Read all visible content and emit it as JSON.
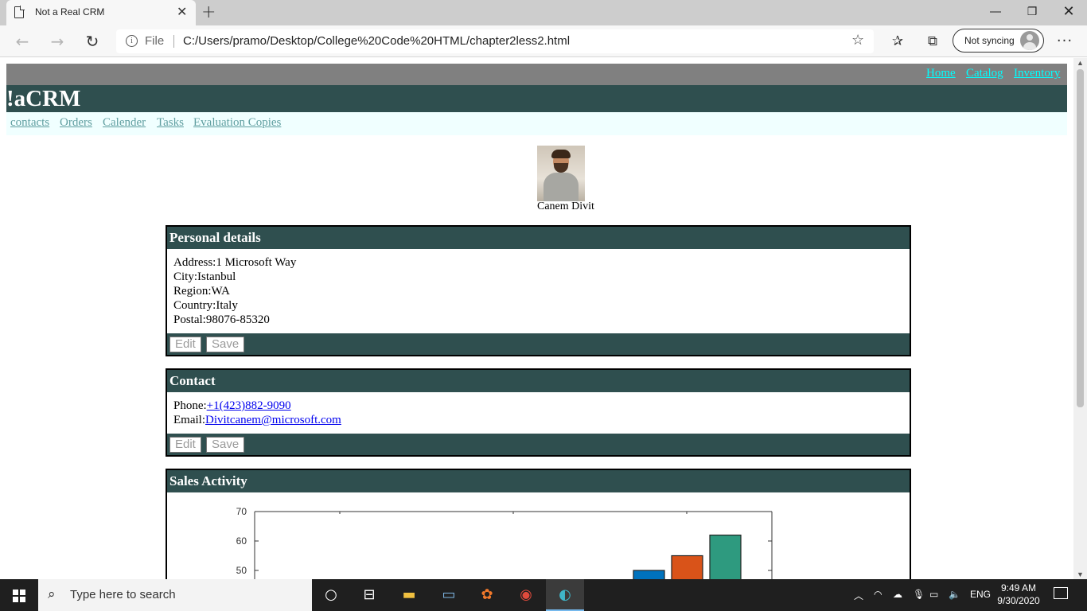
{
  "browser": {
    "tab_title": "Not a Real CRM",
    "address_scheme": "File",
    "address_url": "C:/Users/pramo/Desktop/College%20Code%20HTML/chapter2less2.html",
    "sync_label": "Not syncing"
  },
  "page": {
    "top_links": [
      "Home",
      "Catalog",
      "Inventory"
    ],
    "brand": "!aCRM",
    "sub_links": [
      "contacts",
      "Orders",
      "Calender",
      "Tasks",
      "Evaluation Copies"
    ],
    "profile": {
      "name": "Canem Divit"
    },
    "personal": {
      "title": "Personal details",
      "address": "Address:1 Microsoft Way",
      "city": "City:Istanbul",
      "region": "Region:WA",
      "country": "Country:Italy",
      "postal": "Postal:98076-85320",
      "edit_label": "Edit",
      "save_label": "Save"
    },
    "contact": {
      "title": "Contact",
      "phone_label": "Phone:",
      "phone": "+1(423)882-9090",
      "email_label": "Email:",
      "email": "Divitcanem@microsoft.com",
      "edit_label": "Edit",
      "save_label": "Save"
    },
    "sales": {
      "title": "Sales Activity"
    }
  },
  "chart_data": {
    "type": "bar",
    "ylim": [
      40,
      70
    ],
    "yticks": [
      70,
      60,
      50
    ],
    "series": [
      {
        "color": "#0072bd",
        "values": [
          50
        ]
      },
      {
        "color": "#d95319",
        "values": [
          55
        ]
      },
      {
        "color": "#2e9a7f",
        "values": [
          62
        ]
      }
    ]
  },
  "taskbar": {
    "search_placeholder": "Type here to search",
    "lang": "ENG",
    "time": "9:49 AM",
    "date": "9/30/2020"
  }
}
